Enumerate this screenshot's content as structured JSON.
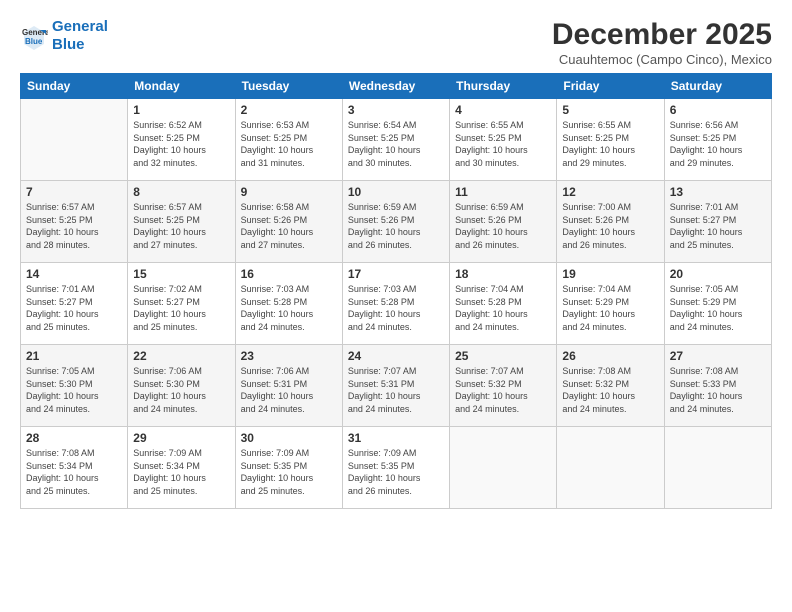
{
  "logo": {
    "line1": "General",
    "line2": "Blue"
  },
  "title": "December 2025",
  "subtitle": "Cuauhtemoc (Campo Cinco), Mexico",
  "days_header": [
    "Sunday",
    "Monday",
    "Tuesday",
    "Wednesday",
    "Thursday",
    "Friday",
    "Saturday"
  ],
  "weeks": [
    [
      {
        "num": "",
        "info": ""
      },
      {
        "num": "1",
        "info": "Sunrise: 6:52 AM\nSunset: 5:25 PM\nDaylight: 10 hours\nand 32 minutes."
      },
      {
        "num": "2",
        "info": "Sunrise: 6:53 AM\nSunset: 5:25 PM\nDaylight: 10 hours\nand 31 minutes."
      },
      {
        "num": "3",
        "info": "Sunrise: 6:54 AM\nSunset: 5:25 PM\nDaylight: 10 hours\nand 30 minutes."
      },
      {
        "num": "4",
        "info": "Sunrise: 6:55 AM\nSunset: 5:25 PM\nDaylight: 10 hours\nand 30 minutes."
      },
      {
        "num": "5",
        "info": "Sunrise: 6:55 AM\nSunset: 5:25 PM\nDaylight: 10 hours\nand 29 minutes."
      },
      {
        "num": "6",
        "info": "Sunrise: 6:56 AM\nSunset: 5:25 PM\nDaylight: 10 hours\nand 29 minutes."
      }
    ],
    [
      {
        "num": "7",
        "info": "Sunrise: 6:57 AM\nSunset: 5:25 PM\nDaylight: 10 hours\nand 28 minutes."
      },
      {
        "num": "8",
        "info": "Sunrise: 6:57 AM\nSunset: 5:25 PM\nDaylight: 10 hours\nand 27 minutes."
      },
      {
        "num": "9",
        "info": "Sunrise: 6:58 AM\nSunset: 5:26 PM\nDaylight: 10 hours\nand 27 minutes."
      },
      {
        "num": "10",
        "info": "Sunrise: 6:59 AM\nSunset: 5:26 PM\nDaylight: 10 hours\nand 26 minutes."
      },
      {
        "num": "11",
        "info": "Sunrise: 6:59 AM\nSunset: 5:26 PM\nDaylight: 10 hours\nand 26 minutes."
      },
      {
        "num": "12",
        "info": "Sunrise: 7:00 AM\nSunset: 5:26 PM\nDaylight: 10 hours\nand 26 minutes."
      },
      {
        "num": "13",
        "info": "Sunrise: 7:01 AM\nSunset: 5:27 PM\nDaylight: 10 hours\nand 25 minutes."
      }
    ],
    [
      {
        "num": "14",
        "info": "Sunrise: 7:01 AM\nSunset: 5:27 PM\nDaylight: 10 hours\nand 25 minutes."
      },
      {
        "num": "15",
        "info": "Sunrise: 7:02 AM\nSunset: 5:27 PM\nDaylight: 10 hours\nand 25 minutes."
      },
      {
        "num": "16",
        "info": "Sunrise: 7:03 AM\nSunset: 5:28 PM\nDaylight: 10 hours\nand 24 minutes."
      },
      {
        "num": "17",
        "info": "Sunrise: 7:03 AM\nSunset: 5:28 PM\nDaylight: 10 hours\nand 24 minutes."
      },
      {
        "num": "18",
        "info": "Sunrise: 7:04 AM\nSunset: 5:28 PM\nDaylight: 10 hours\nand 24 minutes."
      },
      {
        "num": "19",
        "info": "Sunrise: 7:04 AM\nSunset: 5:29 PM\nDaylight: 10 hours\nand 24 minutes."
      },
      {
        "num": "20",
        "info": "Sunrise: 7:05 AM\nSunset: 5:29 PM\nDaylight: 10 hours\nand 24 minutes."
      }
    ],
    [
      {
        "num": "21",
        "info": "Sunrise: 7:05 AM\nSunset: 5:30 PM\nDaylight: 10 hours\nand 24 minutes."
      },
      {
        "num": "22",
        "info": "Sunrise: 7:06 AM\nSunset: 5:30 PM\nDaylight: 10 hours\nand 24 minutes."
      },
      {
        "num": "23",
        "info": "Sunrise: 7:06 AM\nSunset: 5:31 PM\nDaylight: 10 hours\nand 24 minutes."
      },
      {
        "num": "24",
        "info": "Sunrise: 7:07 AM\nSunset: 5:31 PM\nDaylight: 10 hours\nand 24 minutes."
      },
      {
        "num": "25",
        "info": "Sunrise: 7:07 AM\nSunset: 5:32 PM\nDaylight: 10 hours\nand 24 minutes."
      },
      {
        "num": "26",
        "info": "Sunrise: 7:08 AM\nSunset: 5:32 PM\nDaylight: 10 hours\nand 24 minutes."
      },
      {
        "num": "27",
        "info": "Sunrise: 7:08 AM\nSunset: 5:33 PM\nDaylight: 10 hours\nand 24 minutes."
      }
    ],
    [
      {
        "num": "28",
        "info": "Sunrise: 7:08 AM\nSunset: 5:34 PM\nDaylight: 10 hours\nand 25 minutes."
      },
      {
        "num": "29",
        "info": "Sunrise: 7:09 AM\nSunset: 5:34 PM\nDaylight: 10 hours\nand 25 minutes."
      },
      {
        "num": "30",
        "info": "Sunrise: 7:09 AM\nSunset: 5:35 PM\nDaylight: 10 hours\nand 25 minutes."
      },
      {
        "num": "31",
        "info": "Sunrise: 7:09 AM\nSunset: 5:35 PM\nDaylight: 10 hours\nand 26 minutes."
      },
      {
        "num": "",
        "info": ""
      },
      {
        "num": "",
        "info": ""
      },
      {
        "num": "",
        "info": ""
      }
    ]
  ]
}
